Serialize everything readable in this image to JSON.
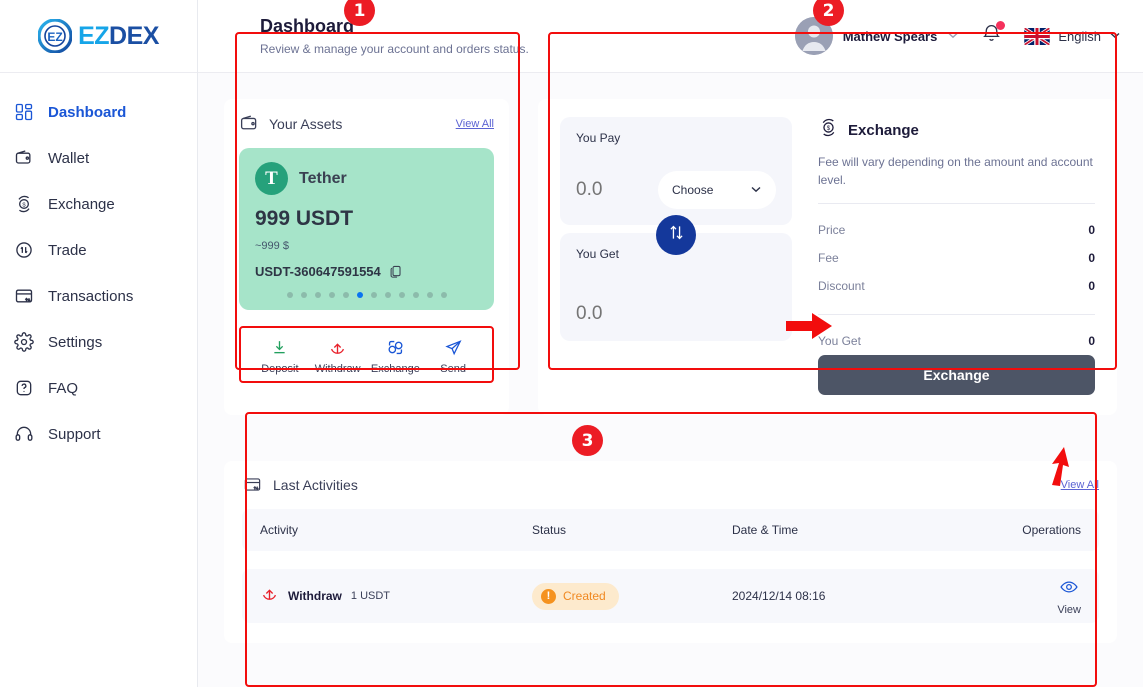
{
  "brand": {
    "name_part1": "EZ",
    "name_part2": "DEX",
    "logo_icon": "ezdex-circle-logo"
  },
  "sidebar": {
    "items": [
      {
        "label": "Dashboard",
        "icon": "grid-icon",
        "active": true
      },
      {
        "label": "Wallet",
        "icon": "wallet-icon",
        "active": false
      },
      {
        "label": "Exchange",
        "icon": "exchange-icon",
        "active": false
      },
      {
        "label": "Trade",
        "icon": "trade-icon",
        "active": false
      },
      {
        "label": "Transactions",
        "icon": "transactions-icon",
        "active": false
      },
      {
        "label": "Settings",
        "icon": "gear-icon",
        "active": false
      },
      {
        "label": "FAQ",
        "icon": "question-icon",
        "active": false
      },
      {
        "label": "Support",
        "icon": "headset-icon",
        "active": false
      }
    ]
  },
  "header": {
    "title": "Dashboard",
    "subtitle": "Review & manage your account and orders status.",
    "user_name": "Mathew Spears",
    "user_caret": "⌄",
    "notification_icon": "bell-icon",
    "has_notification": true,
    "language": "English",
    "language_flag": "uk-flag-icon",
    "language_caret": "⌄"
  },
  "assets": {
    "title": "Your Assets",
    "icon": "wallet-icon",
    "view_all": "View All",
    "coin_name": "Tether",
    "coin_symbol": "T",
    "amount": "999 USDT",
    "usd_value": "~999 $",
    "address": "USDT-360647591554",
    "copy_icon": "copy-icon",
    "dots_total": 12,
    "dots_active_index": 5,
    "tile_color": "#a6e4c9",
    "actions": [
      {
        "label": "Deposit",
        "icon": "deposit-arrow-down-icon",
        "color": "#22a05e"
      },
      {
        "label": "Withdraw",
        "icon": "withdraw-arrow-up-icon",
        "color": "#e8202a"
      },
      {
        "label": "Exchange",
        "icon": "exchange-icon",
        "color": "#1a56d6"
      },
      {
        "label": "Send",
        "icon": "send-plane-icon",
        "color": "#1a56d6"
      }
    ]
  },
  "exchange": {
    "pay_label": "You Pay",
    "pay_value": "",
    "pay_placeholder": "0.0",
    "choose_label": "Choose",
    "get_label": "You Get",
    "get_value": "",
    "get_placeholder": "0.0",
    "swap_icon": "swap-vertical-icon",
    "title": "Exchange",
    "title_icon": "exchange-icon",
    "description": "Fee will vary depending on the amount and account level.",
    "rows": [
      {
        "key": "Price",
        "value": "0"
      },
      {
        "key": "Fee",
        "value": "0"
      },
      {
        "key": "Discount",
        "value": "0"
      }
    ],
    "total_key": "You Get",
    "total_value": "0",
    "button_label": "Exchange",
    "button_color": "#4d5566"
  },
  "activities": {
    "title": "Last Activities",
    "icon": "transactions-icon",
    "view_all": "View All",
    "columns": [
      "Activity",
      "Status",
      "Date & Time",
      "Operations"
    ],
    "rows": [
      {
        "activity_icon": "withdraw-arrow-up-icon",
        "activity": "Withdraw",
        "amount": "1 USDT",
        "status": "Created",
        "status_color": "#f08922",
        "status_bg": "#fdeacd",
        "datetime": "2024/12/14 08:16",
        "operation_label": "View",
        "operation_icon": "eye-icon"
      }
    ]
  },
  "annotations": {
    "markers": [
      {
        "number": "1"
      },
      {
        "number": "2"
      },
      {
        "number": "3"
      }
    ],
    "color": "#ec1c24"
  }
}
